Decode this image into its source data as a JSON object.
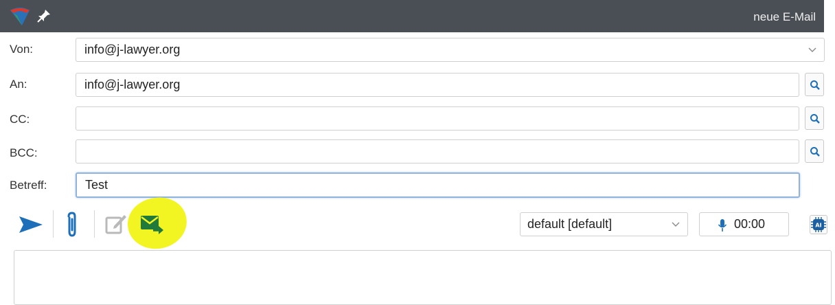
{
  "window": {
    "title": "neue E-Mail"
  },
  "form": {
    "from_label": "Von:",
    "from_value": "info@j-lawyer.org",
    "to_label": "An:",
    "to_value": "info@j-lawyer.org",
    "cc_label": "CC:",
    "cc_value": "",
    "bcc_label": "BCC:",
    "bcc_value": "",
    "subject_label": "Betreff:",
    "subject_value": "Test"
  },
  "toolbar": {
    "profile_select": "default [default]",
    "record_time": "00:00",
    "ai_label": "AI"
  },
  "icons": {
    "send": "send-icon",
    "attach": "paperclip-icon",
    "edit": "edit-icon",
    "email_forward": "email-forward-icon",
    "search": "search-icon",
    "mic": "microphone-icon",
    "ai": "ai-chip-icon",
    "pin": "pin-icon",
    "logo": "app-logo"
  },
  "colors": {
    "titlebar": "#4a4e55",
    "accent_blue": "#1c6fb8",
    "highlight": "#f3f523",
    "forward_green": "#1f7a3b"
  }
}
